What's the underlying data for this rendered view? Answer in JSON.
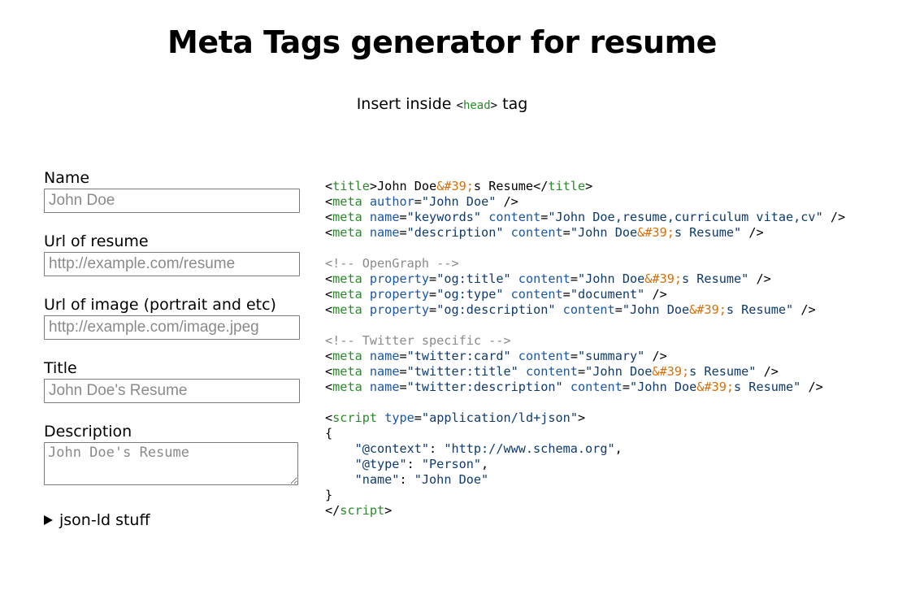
{
  "page_title": "Meta Tags generator for resume",
  "subtitle": {
    "prefix": "Insert inside ",
    "code_open": "<",
    "code_tag": "head",
    "code_close": ">",
    "suffix": " tag"
  },
  "form": {
    "name": {
      "label": "Name",
      "placeholder": "John Doe"
    },
    "resume_url": {
      "label": "Url of resume",
      "placeholder": "http://example.com/resume"
    },
    "image_url": {
      "label": "Url of image (portrait and etc)",
      "placeholder": "http://example.com/image.jpeg"
    },
    "title": {
      "label": "Title",
      "placeholder": "John Doe's Resume"
    },
    "description": {
      "label": "Description",
      "placeholder": "John Doe's Resume"
    },
    "details_label": "json-ld stuff"
  },
  "output": {
    "name": "John Doe",
    "entity": "&#39;",
    "title_suffix": "s Resume",
    "keywords": "John Doe,resume,curriculum vitae,cv",
    "og_comment": "<!-- OpenGraph -->",
    "og_type": "document",
    "twitter_comment": "<!-- Twitter specific -->",
    "twitter_card": "summary",
    "script_type": "application/ld+json",
    "ld_context_key": "\"@context\"",
    "ld_context_val": "\"http://www.schema.org\"",
    "ld_type_key": "\"@type\"",
    "ld_type_val": "\"Person\"",
    "ld_name_key": "\"name\"",
    "ld_name_val": "\"John Doe\""
  }
}
